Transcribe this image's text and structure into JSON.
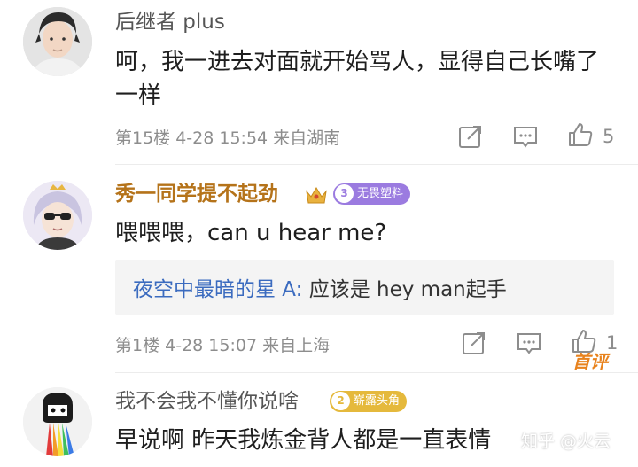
{
  "comments": [
    {
      "username": "后继者 plus",
      "text": "呵，我一进去对面就开始骂人，显得自己长嘴了一样",
      "meta": "第15楼 4-28 15:54 来自湖南",
      "likes": "5"
    },
    {
      "username": "秀一同学提不起劲",
      "badge_level": "3",
      "badge_title": "无畏塑料",
      "first_tag": "首评",
      "text": "喂喂喂，can u hear me?",
      "reply_author": "夜空中最暗的星 A:",
      "reply_text": " 应该是 hey man起手",
      "meta": "第1楼 4-28 15:07 来自上海",
      "likes": "1"
    },
    {
      "username": "我不会我不懂你说啥",
      "badge_level": "2",
      "badge_title": "崭露头角",
      "text": "早说啊 昨天我炼金背人都是一直表情"
    }
  ],
  "watermark": "知乎 @火云",
  "colors": {
    "gold_name": "#b5731a",
    "reply_author": "#3b6bbf",
    "badge_purple": "#9b7be0",
    "badge_gold": "#e5b93c",
    "first_tag": "#e8821c"
  }
}
